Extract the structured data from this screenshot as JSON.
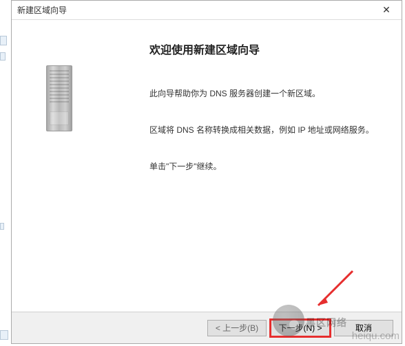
{
  "titlebar": {
    "title": "新建区域向导",
    "close_glyph": "✕"
  },
  "content": {
    "heading": "欢迎使用新建区域向导",
    "para1": "此向导帮助你为 DNS 服务器创建一个新区域。",
    "para2": "区域将 DNS 名称转换成相关数据，例如 IP 地址或网络服务。",
    "para3": "单击\"下一步\"继续。"
  },
  "footer": {
    "back_label": "< 上一步(B)",
    "next_label": "下一步(N) >",
    "cancel_label": "取消"
  },
  "watermark": {
    "cn": "黑区网络",
    "url": "heiqu.com"
  }
}
